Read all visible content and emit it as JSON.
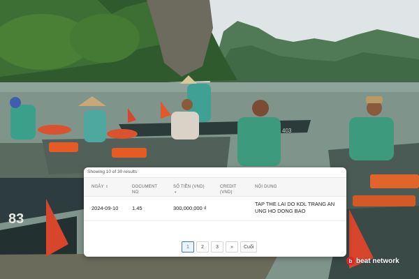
{
  "table": {
    "results_text": "Showing 10 of 30 results",
    "columns": [
      {
        "label": "NGÀY",
        "sortable": true
      },
      {
        "label": "DOCUMENT NO",
        "sortable": false
      },
      {
        "label": "SỐ TIỀN (VND)",
        "sortable": true
      },
      {
        "label": "CREDIT (VND)",
        "sortable": false
      },
      {
        "label": "NỘI DUNG",
        "sortable": false
      }
    ],
    "rows": [
      {
        "date": "2024-09-10",
        "document_no": "1.45",
        "amount": "300,000,000 ₫",
        "credit": "",
        "content": "TAP THE LAI DO KDL TRANG AN UNG HO DONG BAO"
      }
    ]
  },
  "pagination": {
    "pages": [
      "1",
      "2",
      "3"
    ],
    "active_page": "1",
    "next_label": "»",
    "last_label": "Cuối"
  },
  "watermark": {
    "text": "beat network",
    "color": "#e32626"
  },
  "photo": {
    "boat_number": "83",
    "boat_text": "403"
  }
}
